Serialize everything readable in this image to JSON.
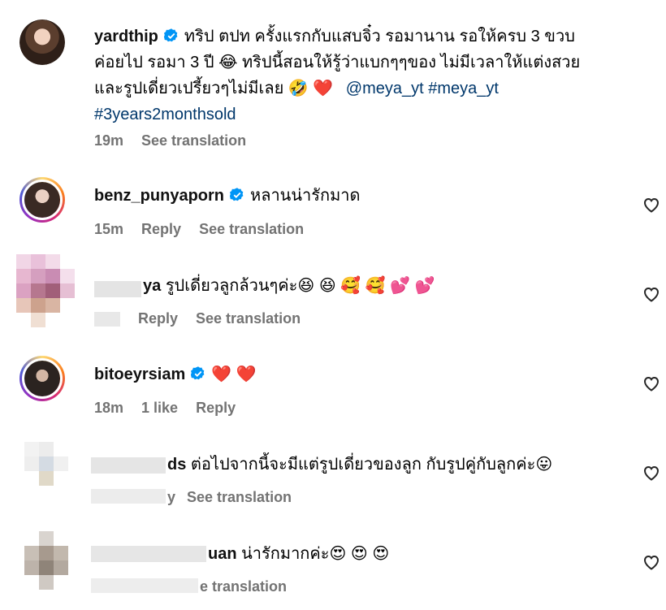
{
  "post": {
    "username": "yardthip",
    "caption_line1": "ทริป ตปท ครั้งแรกกับแสบจิ๋ว รอมานาน รอให้ครบ 3 ขวบ",
    "caption_line2": "ค่อยไป รอมา 3 ปี 😂 ทริปนี้สอนให้รู้ว่าแบกๆๆของ ไม่มีเวลาให้แต่งสวย",
    "caption_line3": "และรูปเดี่ยวเปรี้ยวๆไม่มีเลย 🤣 ❤️",
    "mention": "@meya_yt",
    "hashtag1": "#meya_yt",
    "hashtag2": "#3years2monthsold",
    "time": "19m",
    "see_translation": "See translation"
  },
  "comments": [
    {
      "username": "benz_punyaporn",
      "verified": true,
      "text": "หลานน่ารักมาด",
      "time": "15m",
      "reply": "Reply",
      "see_translation": "See translation"
    },
    {
      "username_visible": "ya",
      "text": "รูปเดี่ยวลูกล้วนๆค่ะ😆 😆 🥰 🥰 💕 💕",
      "reply": "Reply",
      "see_translation": "See translation"
    },
    {
      "username": "bitoeyrsiam",
      "verified": true,
      "text": "❤️ ❤️",
      "time": "18m",
      "likes": "1 like",
      "reply": "Reply"
    },
    {
      "username_visible": "ds",
      "text": "ต่อไปจากนี้จะมีแต่รูปเดี่ยวของลูก กับรูปคู่กับลูกค่ะ😛",
      "meta_visible": "y",
      "see_translation": "See translation"
    },
    {
      "username_visible": "uan",
      "text": "น่ารักมากค่ะ😍 😍 😍",
      "see_translation_visible": "e translation"
    }
  ],
  "icons": {
    "verified": "verified-badge-icon",
    "like": "heart-outline-icon"
  },
  "colors": {
    "verified": "#0095f6",
    "link": "#00376b",
    "meta": "#737373"
  }
}
